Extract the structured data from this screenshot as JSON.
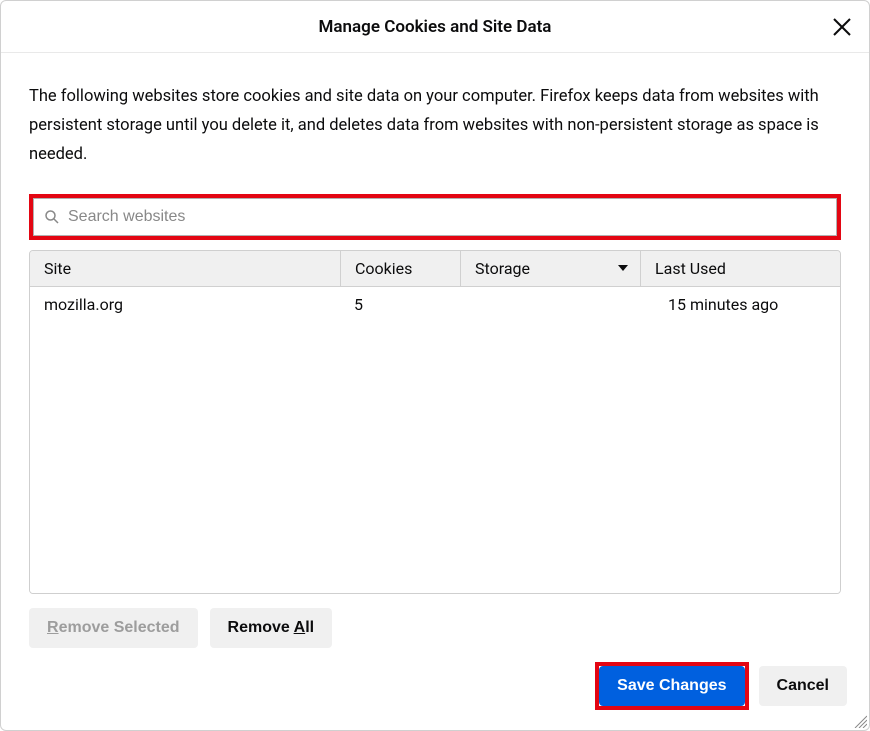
{
  "header": {
    "title": "Manage Cookies and Site Data"
  },
  "description": "The following websites store cookies and site data on your computer. Firefox keeps data from websites with persistent storage until you delete it, and deletes data from websites with non-persistent storage as space is needed.",
  "search": {
    "placeholder": "Search websites"
  },
  "table": {
    "headers": {
      "site": "Site",
      "cookies": "Cookies",
      "storage": "Storage",
      "lastUsed": "Last Used"
    },
    "rows": [
      {
        "site": "mozilla.org",
        "cookies": "5",
        "storage": "",
        "lastUsed": "15 minutes ago"
      }
    ]
  },
  "buttons": {
    "removeSelectedPrefix": "R",
    "removeSelectedRest": "emove Selected",
    "removeAllPrefix": "R",
    "removeAllMid": "emove ",
    "removeAllUnderline": "A",
    "removeAllSuffix": "ll",
    "saveChanges": "Save Changes",
    "cancel": "Cancel"
  }
}
